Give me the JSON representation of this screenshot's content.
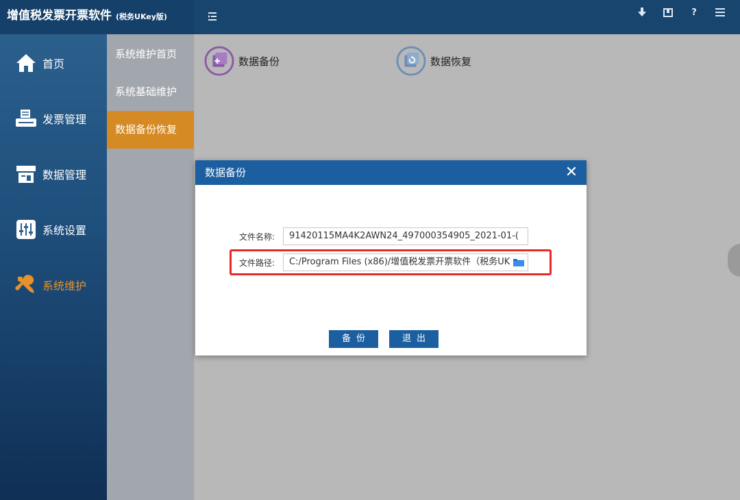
{
  "app": {
    "title": "增值税发票开票软件",
    "subtitle": "(税务UKey版)"
  },
  "topbar": {
    "help_glyph": "?"
  },
  "nav": {
    "items": [
      {
        "label": "首页",
        "icon": "home-icon"
      },
      {
        "label": "发票管理",
        "icon": "printer-icon"
      },
      {
        "label": "数据管理",
        "icon": "data-icon"
      },
      {
        "label": "系统设置",
        "icon": "sliders-icon"
      },
      {
        "label": "系统维护",
        "icon": "tools-icon"
      }
    ],
    "active_index": 4,
    "active_color": "#e6922a"
  },
  "subnav": {
    "items": [
      {
        "label": "系统维护首页"
      },
      {
        "label": "系统基础维护"
      },
      {
        "label": "数据备份恢复"
      }
    ],
    "active_index": 2
  },
  "main": {
    "tools": [
      {
        "label": "数据备份",
        "icon": "backup-icon"
      },
      {
        "label": "数据恢复",
        "icon": "restore-icon"
      }
    ]
  },
  "dialog": {
    "title": "数据备份",
    "close_glyph": "✕",
    "filename_label": "文件名称:",
    "filename_value": "91420115MA4K2AWN24_497000354905_2021-01-(",
    "filepath_label": "文件路径:",
    "filepath_value": "C:/Program Files (x86)/增值税发票开票软件（税务UK",
    "backup_button": "备份",
    "exit_button": "退出",
    "highlight_color": "#e62828",
    "accent_color": "#1c5fa0"
  }
}
